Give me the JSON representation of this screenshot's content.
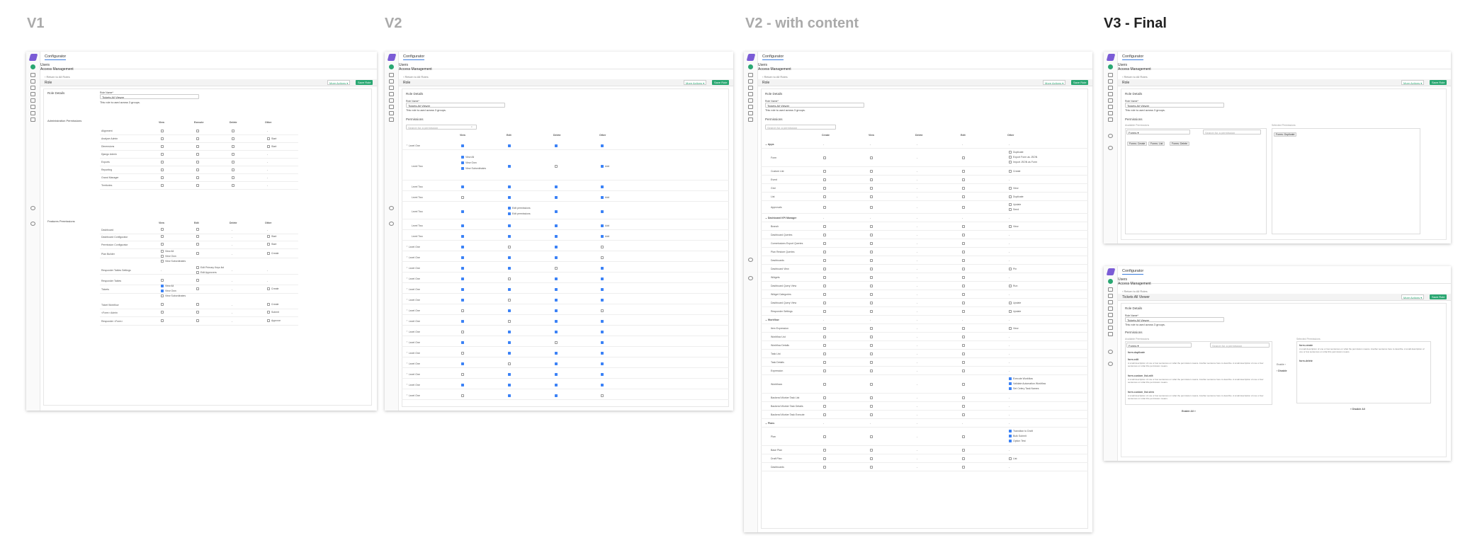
{
  "versions": {
    "v1": "V1",
    "v2": "V2",
    "v2c": "V2 - with content",
    "v3": "V3 - Final"
  },
  "app": {
    "title": "Configurator",
    "tab_users": "Users",
    "tab_access": "Access Management",
    "back": "Return to All Roles",
    "role": "Role",
    "more_actions": "More Actions",
    "save_role": "Save Role",
    "final_title": "Tickets All Viewer"
  },
  "form": {
    "role_details": "Role Details",
    "role_name_label": "Role Name*",
    "role_name_value": "Tickets All Viewer",
    "used_note": "This role is used across 3 groups.",
    "permissions": "Permissions",
    "search_placeholder": "Search for a permission"
  },
  "v1": {
    "admin_heading": "Administration Permissions",
    "features_heading": "Features Permissions",
    "admin_cols": [
      "View",
      "Execute",
      "Delete",
      "Other"
    ],
    "feat_cols": [
      "View",
      "Edit",
      "Delete",
      "Other"
    ],
    "admin_rows": [
      "Alignment",
      "Analyze Admin",
      "Dimensions",
      "Django Admin",
      "Exports",
      "Reporting",
      "Grand Manager",
      "Territories"
    ],
    "admin_other": [
      "-",
      "Start",
      "Start",
      "-",
      "-",
      "-",
      "-",
      "-"
    ],
    "feat_rows": [
      "Dashboard",
      "Dashboard Configurator",
      "Permission Configurator",
      "Plan Builder",
      "Responder Tables Settings",
      "Responder Tables",
      "Tickets",
      "Ticket Workflow",
      "<Form> Admin",
      "Responder <Form>"
    ],
    "feat_other": [
      "-",
      "Start",
      "Start",
      "Create",
      "-",
      "-",
      "Create",
      "Create",
      "Submit",
      "Approve"
    ],
    "plan_sub": [
      "View All",
      "View Own",
      "View Subordinates"
    ],
    "rts_sub": [
      "Edit Primary Keys list",
      "Edit Approvers"
    ],
    "tickets_sub": [
      "View All",
      "View Own",
      "View Subordinates"
    ]
  },
  "v2": {
    "cols": [
      "View",
      "Edit",
      "Delete",
      "Other"
    ],
    "level_one": "Level One",
    "level_two": "Level Two",
    "sub_view": [
      "View All",
      "View Own",
      "View Subordinates"
    ],
    "edit_perms": "Edit permissions",
    "add": "Add"
  },
  "v2c": {
    "cols": [
      "Create",
      "View",
      "Delete",
      "Edit",
      "Other"
    ],
    "rows": [
      "Apps",
      "Form",
      "Custom List",
      "Event",
      "Grid",
      "List",
      "Approvals",
      "Dashboard KPI Manager",
      "Branch",
      "Dashboard Queries",
      "Commissions Export Queries",
      "Plan Restore Queries",
      "Dashboards",
      "Dashboard View",
      "Widgets",
      "Dashboard Query View",
      "Widget Categories",
      "Dashboard Query View",
      "Responder Settings",
      "Workflow",
      "Item Expression",
      "Workflow List",
      "Workflow Details",
      "Task List",
      "Task Details",
      "Expression",
      "Workflows",
      "Backend Worker Task List",
      "Backend Worker Task Details",
      "Backend Worker Task Execute",
      "Plans",
      "Plan",
      "Base Plan",
      "Draft Plan",
      "Dashboards"
    ],
    "other": [
      "-",
      "Duplicate",
      "Create",
      "-",
      "View",
      "Duplicate",
      "Update",
      "-",
      "View",
      "-",
      "-",
      "-",
      "-",
      "Pin",
      "-",
      "Run",
      "-",
      "Update",
      "Update",
      "-",
      "View",
      "-",
      "-",
      "-",
      "-",
      "-",
      "Execute Workflow",
      "-",
      "-",
      "-",
      "-",
      "Transition to Draft",
      "-",
      "List",
      "-"
    ],
    "form_other": [
      "Duplicate",
      "Export Form as JSON",
      "Import JSON as Form"
    ],
    "approvals_other": [
      "Update",
      "Send"
    ],
    "workflows_other": [
      "Execute Workflow",
      "Validate Automation Workflow",
      "Set Celery Task Names"
    ],
    "plan_other": [
      "Transition to Draft",
      "Bulk Submit",
      "Option Test"
    ]
  },
  "v3": {
    "available": "Available Permissions",
    "selected": "Selected Permissions",
    "select_placeholder": "Forms",
    "available_pills": [
      "Forms: Create",
      "Forms: List",
      "Forms: Delete"
    ],
    "selected_pills": [
      "Forms: Duplicate"
    ],
    "perms": [
      {
        "name": "form.duplicate",
        "desc": ""
      },
      {
        "name": "form.edit",
        "desc": "A small description of one or few sentences on what the permission means. Another sentence here to describe. A small description of one or few sentences on what this permission means."
      },
      {
        "name": "form.custom_list-edit",
        "desc": "A small description of one or few sentences on what the permission means. Another sentence here to describe. A small description of one or few sentences on what this permission means."
      },
      {
        "name": "form.custom_list-view",
        "desc": "A small description of one or few sentences on what the permission means. Another sentence here to describe. A small description of one or few sentences on what this permission means."
      }
    ],
    "selected_perms": [
      {
        "name": "form.create",
        "desc": "A small description of one or few sentences on what the permission means. Another sentence here to describe. A small description of one or few sentences on what this permission means."
      },
      {
        "name": "form.delete",
        "desc": ""
      }
    ],
    "enable": "Enable",
    "disable": "Disable",
    "enable_all": "Enable All",
    "disable_all": "Disable All"
  }
}
